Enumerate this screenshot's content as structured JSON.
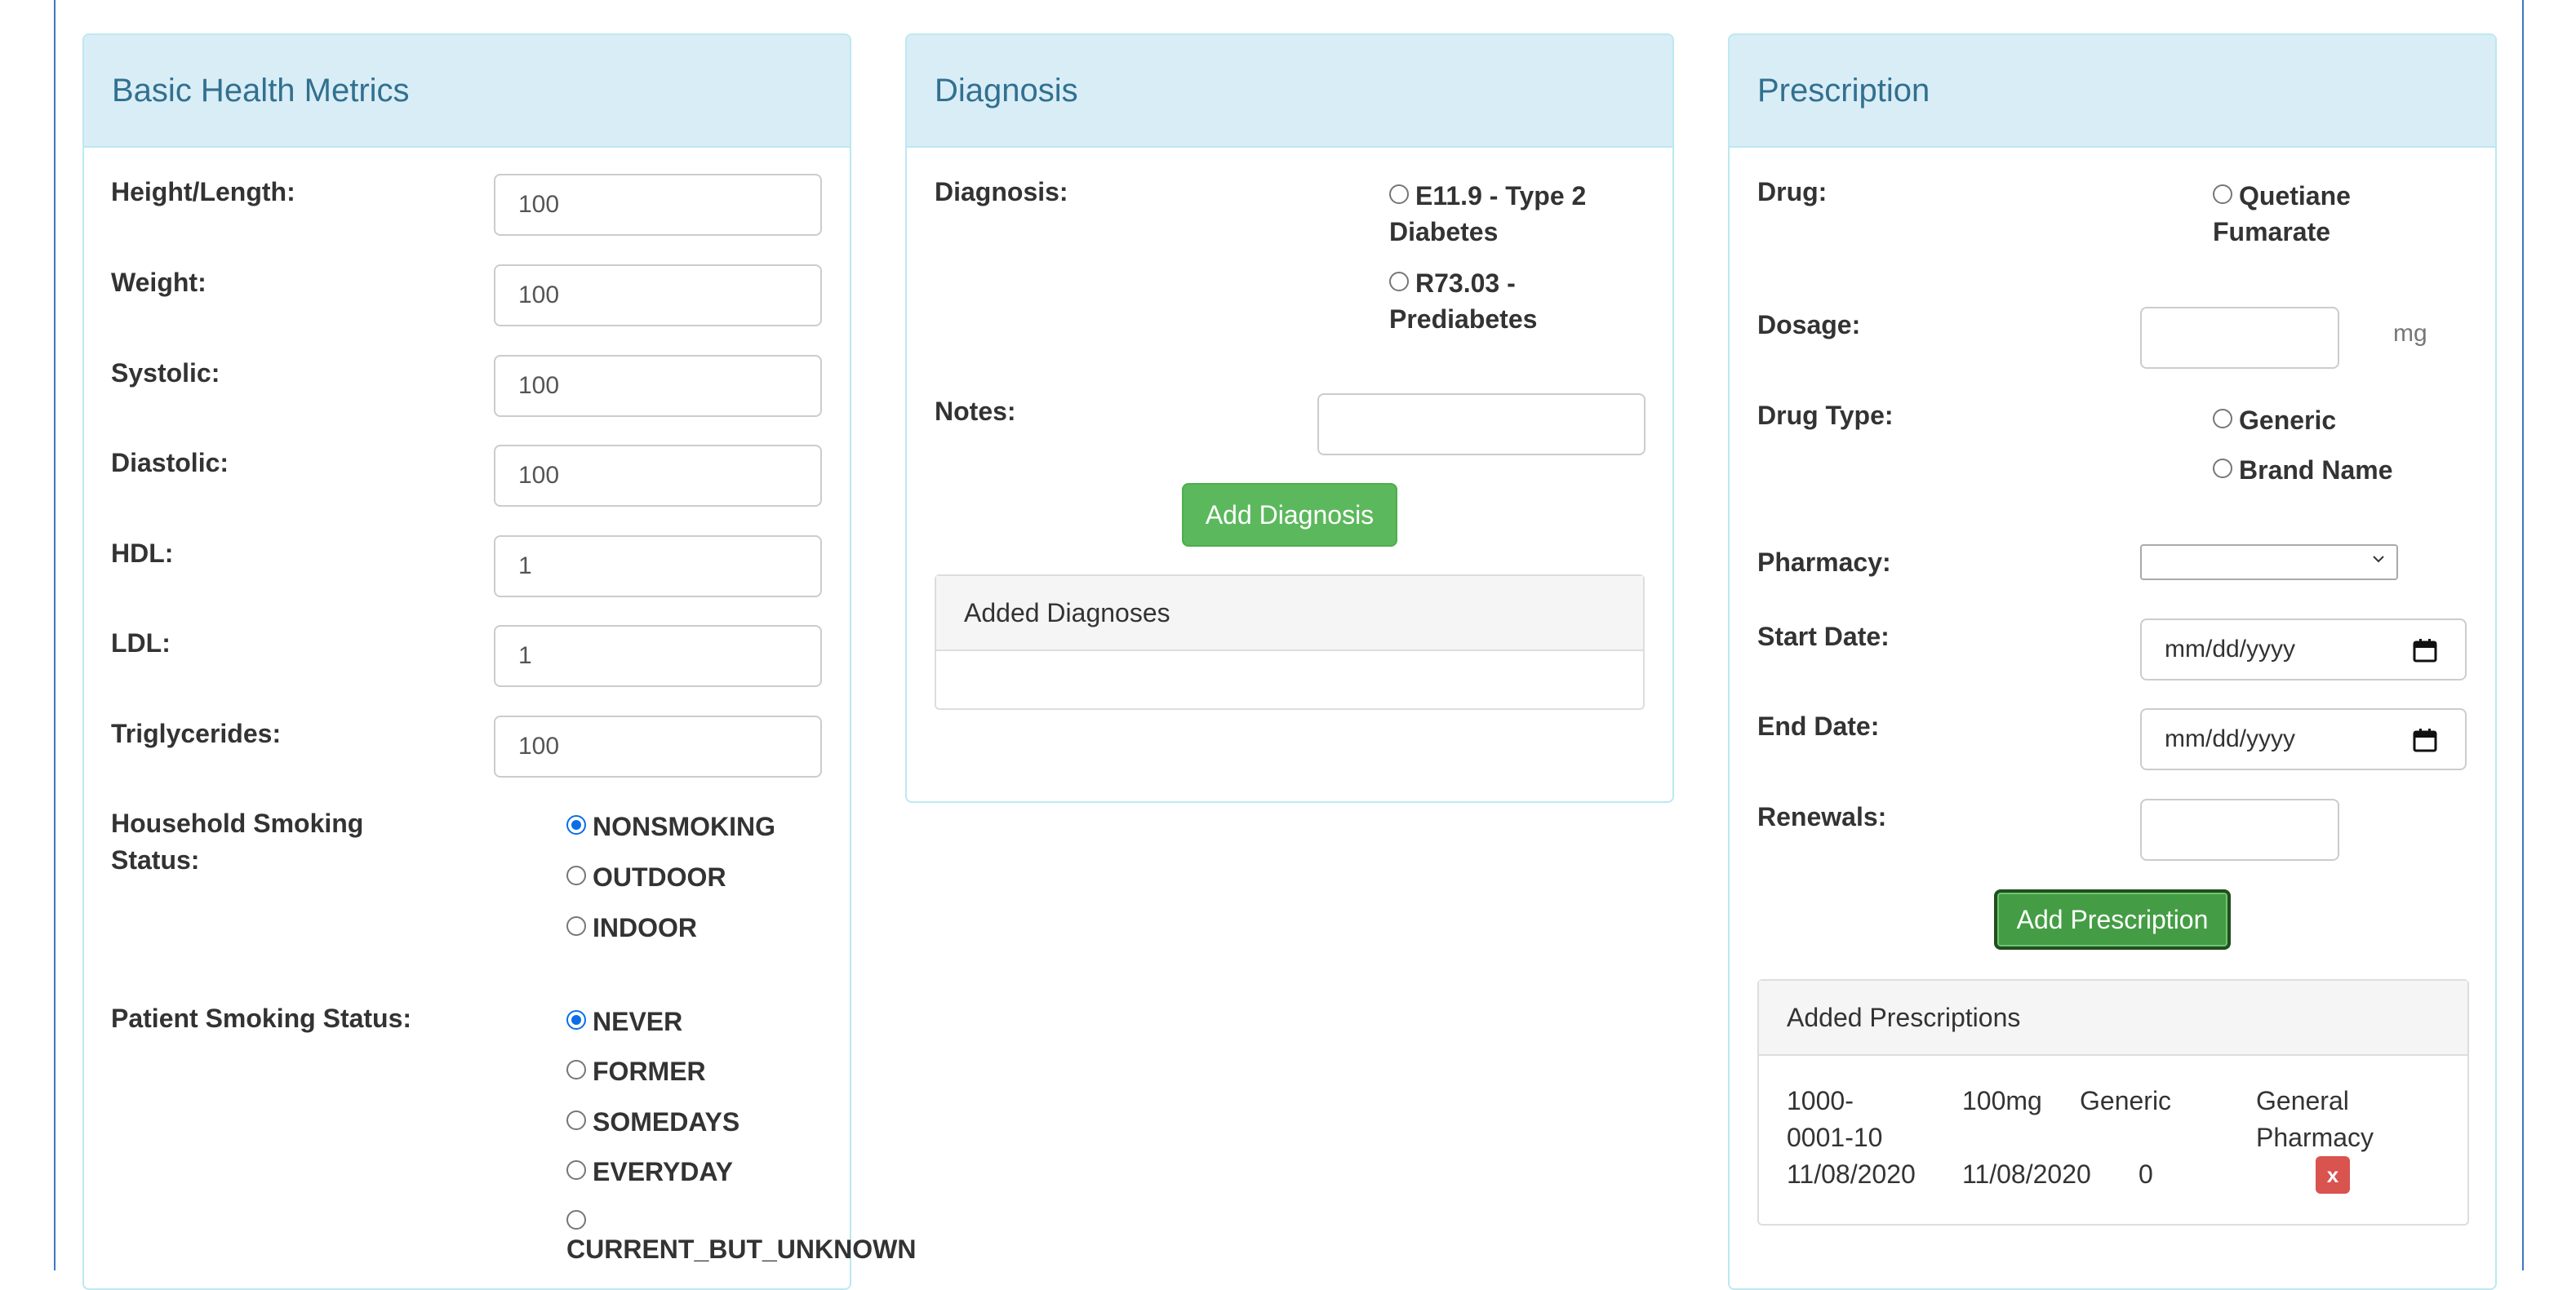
{
  "health": {
    "title": "Basic Health Metrics",
    "height_label": "Height/Length:",
    "height_value": "100",
    "weight_label": "Weight:",
    "weight_value": "100",
    "systolic_label": "Systolic:",
    "systolic_value": "100",
    "diastolic_label": "Diastolic:",
    "diastolic_value": "100",
    "hdl_label": "HDL:",
    "hdl_value": "1",
    "ldl_label": "LDL:",
    "ldl_value": "1",
    "trig_label": "Triglycerides:",
    "trig_value": "100",
    "household_label_1": "Household Smoking",
    "household_label_2": "Status:",
    "household_options": [
      "NONSMOKING",
      "OUTDOOR",
      "INDOOR"
    ],
    "household_selected": "NONSMOKING",
    "patient_label": "Patient Smoking Status:",
    "patient_options": [
      "NEVER",
      "FORMER",
      "SOMEDAYS",
      "EVERYDAY",
      "CURRENT_BUT_UNKNOWN"
    ],
    "patient_selected": "NEVER"
  },
  "diagnosis": {
    "title": "Diagnosis",
    "diagnosis_label": "Diagnosis:",
    "option1_line1": "E11.9 - Type 2",
    "option1_line2": "Diabetes",
    "option2_line1": "R73.03 -",
    "option2_line2": "Prediabetes",
    "notes_label": "Notes:",
    "notes_value": "",
    "add_button": "Add Diagnosis",
    "added_heading": "Added Diagnoses"
  },
  "prescription": {
    "title": "Prescription",
    "drug_label": "Drug:",
    "drug_option_line1": "Quetiane",
    "drug_option_line2": "Fumarate",
    "dosage_label": "Dosage:",
    "dosage_value": "",
    "dosage_unit": "mg",
    "drug_type_label": "Drug Type:",
    "drug_type_options": [
      "Generic",
      "Brand Name"
    ],
    "pharmacy_label": "Pharmacy:",
    "pharmacy_value": "",
    "start_label": "Start Date:",
    "start_placeholder": "mm/dd/yyyy",
    "end_label": "End Date:",
    "end_placeholder": "mm/dd/yyyy",
    "renewals_label": "Renewals:",
    "renewals_value": "",
    "add_button": "Add Prescription",
    "added_heading": "Added Prescriptions",
    "added_rows": [
      {
        "code_line1": "1000-",
        "code_line2": "0001-10",
        "dosage": "100mg",
        "type": "Generic",
        "pharmacy_line1": "General",
        "pharmacy_line2": "Pharmacy",
        "start": "11/08/2020",
        "end": "11/08/2020",
        "renewals": "0",
        "delete": "x"
      }
    ]
  }
}
